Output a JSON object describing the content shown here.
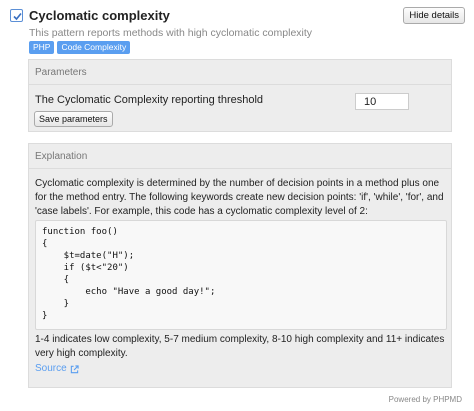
{
  "rule": {
    "title": "Cyclomatic complexity",
    "hide_label": "Hide details",
    "description": "This pattern reports methods with high cyclomatic complexity",
    "tags": [
      "PHP",
      "Code Complexity"
    ]
  },
  "parameters": {
    "heading": "Parameters",
    "threshold_label": "The Cyclomatic Complexity reporting threshold",
    "threshold_value": "10",
    "save_label": "Save parameters"
  },
  "explanation": {
    "heading": "Explanation",
    "intro": "Cyclomatic complexity is determined by the number of decision points in a method plus one for the method entry. The following keywords create new decision points: 'if', 'while', 'for', and 'case labels'. For example, this code has a cyclomatic complexity level of 2:",
    "code": "function foo()\n{\n    $t=date(\"H\");\n    if ($t<\"20\")\n    {\n        echo \"Have a good day!\";\n    }\n}",
    "levels": "1-4 indicates low complexity, 5-7 medium complexity, 8-10 high complexity and 11+ indicates very high complexity.",
    "source_label": "Source"
  },
  "footer": {
    "powered_by": "Powered by PHPMD"
  },
  "colors": {
    "accent": "#5a9ef0",
    "panel_bg": "#ededed"
  },
  "icons": {
    "checkbox": "check-icon",
    "source": "external-link-icon"
  }
}
